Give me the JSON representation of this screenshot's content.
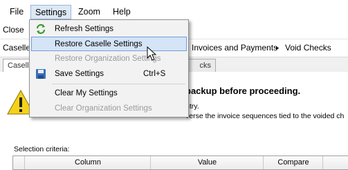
{
  "menubar": {
    "file": "File",
    "settings": "Settings",
    "zoom": "Zoom",
    "help": "Help"
  },
  "toolbar": {
    "close": "Close"
  },
  "breadcrumb": {
    "root": "Caselle",
    "middle": "Invoices and Payments",
    "separator": "▸",
    "current": "Void Checks"
  },
  "tabs": [
    {
      "label": "Caselle"
    },
    {
      "label": "cks"
    }
  ],
  "warning": {
    "title": "backup before proceeding.",
    "line1": "ntry.",
    "line2": "verse the invoice sequences tied to the voided ch"
  },
  "criteria": {
    "label": "Selection criteria:",
    "columns": [
      "Column",
      "Value",
      "Compare"
    ]
  },
  "settings_menu": {
    "items": [
      {
        "label": "Refresh Settings",
        "enabled": true,
        "icon": "refresh-icon"
      },
      {
        "label": "Restore Caselle Settings",
        "enabled": true,
        "highlighted": true
      },
      {
        "label": "Restore Organization Settings",
        "enabled": false
      },
      {
        "label": "Save Settings",
        "shortcut": "Ctrl+S",
        "enabled": true,
        "icon": "save-icon"
      },
      {
        "label": "Clear My Settings",
        "enabled": true
      },
      {
        "label": "Clear Organization Settings",
        "enabled": false
      }
    ]
  },
  "colors": {
    "highlight_bg": "#d5e4f7",
    "highlight_border": "#6f9fdb",
    "disabled_text": "#9a9a9a",
    "warning_yellow": "#f5d21a"
  }
}
